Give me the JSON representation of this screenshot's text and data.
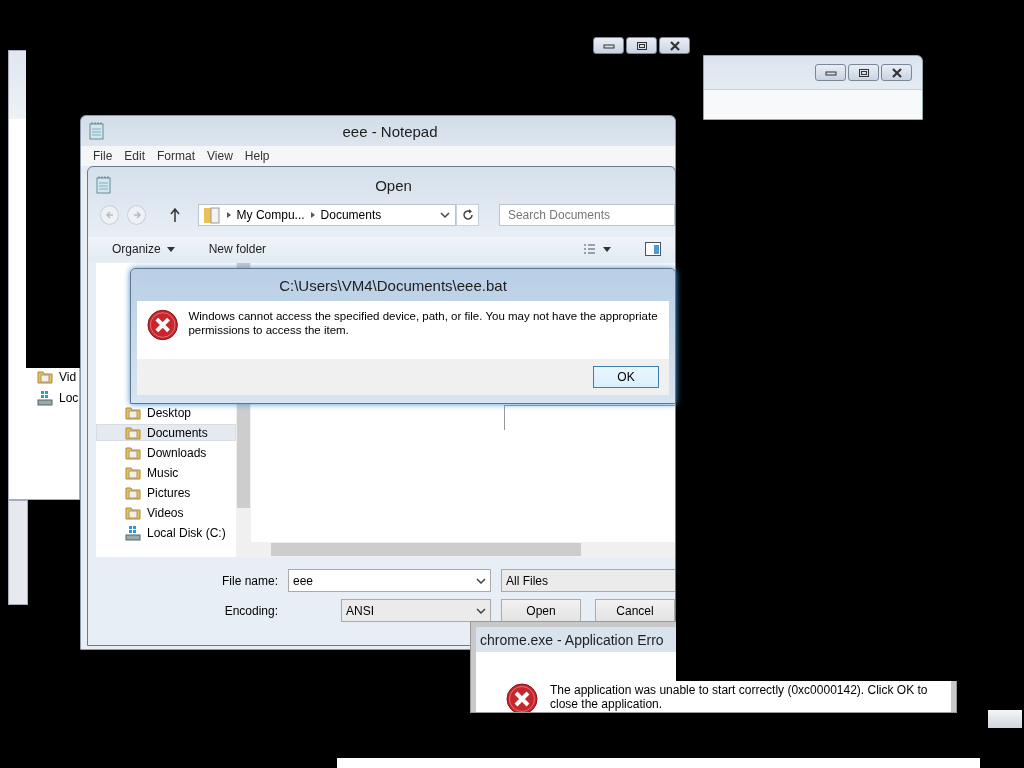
{
  "left_window": {
    "items": [
      {
        "label": "Vid",
        "kind": "folder"
      },
      {
        "label": "Loc",
        "kind": "drive"
      }
    ]
  },
  "notepad": {
    "title": "eee - Notepad",
    "menu": [
      "File",
      "Edit",
      "Format",
      "View",
      "Help"
    ]
  },
  "open_dialog": {
    "title": "Open",
    "breadcrumb": [
      "My Compu...",
      "Documents"
    ],
    "search": {
      "placeholder": "Search Documents"
    },
    "toolbar": [
      "Organize",
      "New folder"
    ],
    "nav_items": [
      {
        "label": "Desktop",
        "kind": "folder",
        "selected": false
      },
      {
        "label": "Documents",
        "kind": "folder",
        "selected": true
      },
      {
        "label": "Downloads",
        "kind": "folder",
        "selected": false
      },
      {
        "label": "Music",
        "kind": "folder",
        "selected": false
      },
      {
        "label": "Pictures",
        "kind": "folder",
        "selected": false
      },
      {
        "label": "Videos",
        "kind": "folder",
        "selected": false
      },
      {
        "label": "Local Disk (C:)",
        "kind": "drive",
        "selected": false
      }
    ],
    "file_name_label": "File name:",
    "file_name": "eee",
    "file_type": "All Files",
    "encoding_label": "Encoding:",
    "encoding": "ANSI",
    "buttons": [
      "Open",
      "Cancel"
    ]
  },
  "error_dialog": {
    "title": "C:\\Users\\VM4\\Documents\\eee.bat",
    "message": "Windows cannot access the specified device, path, or file. You may not have the appropriate permissions to access the item.",
    "button": "OK"
  },
  "app_error": {
    "title": "chrome.exe - Application Erro",
    "message": "The application was unable to start correctly (0xc0000142). Click OK to close the application."
  }
}
